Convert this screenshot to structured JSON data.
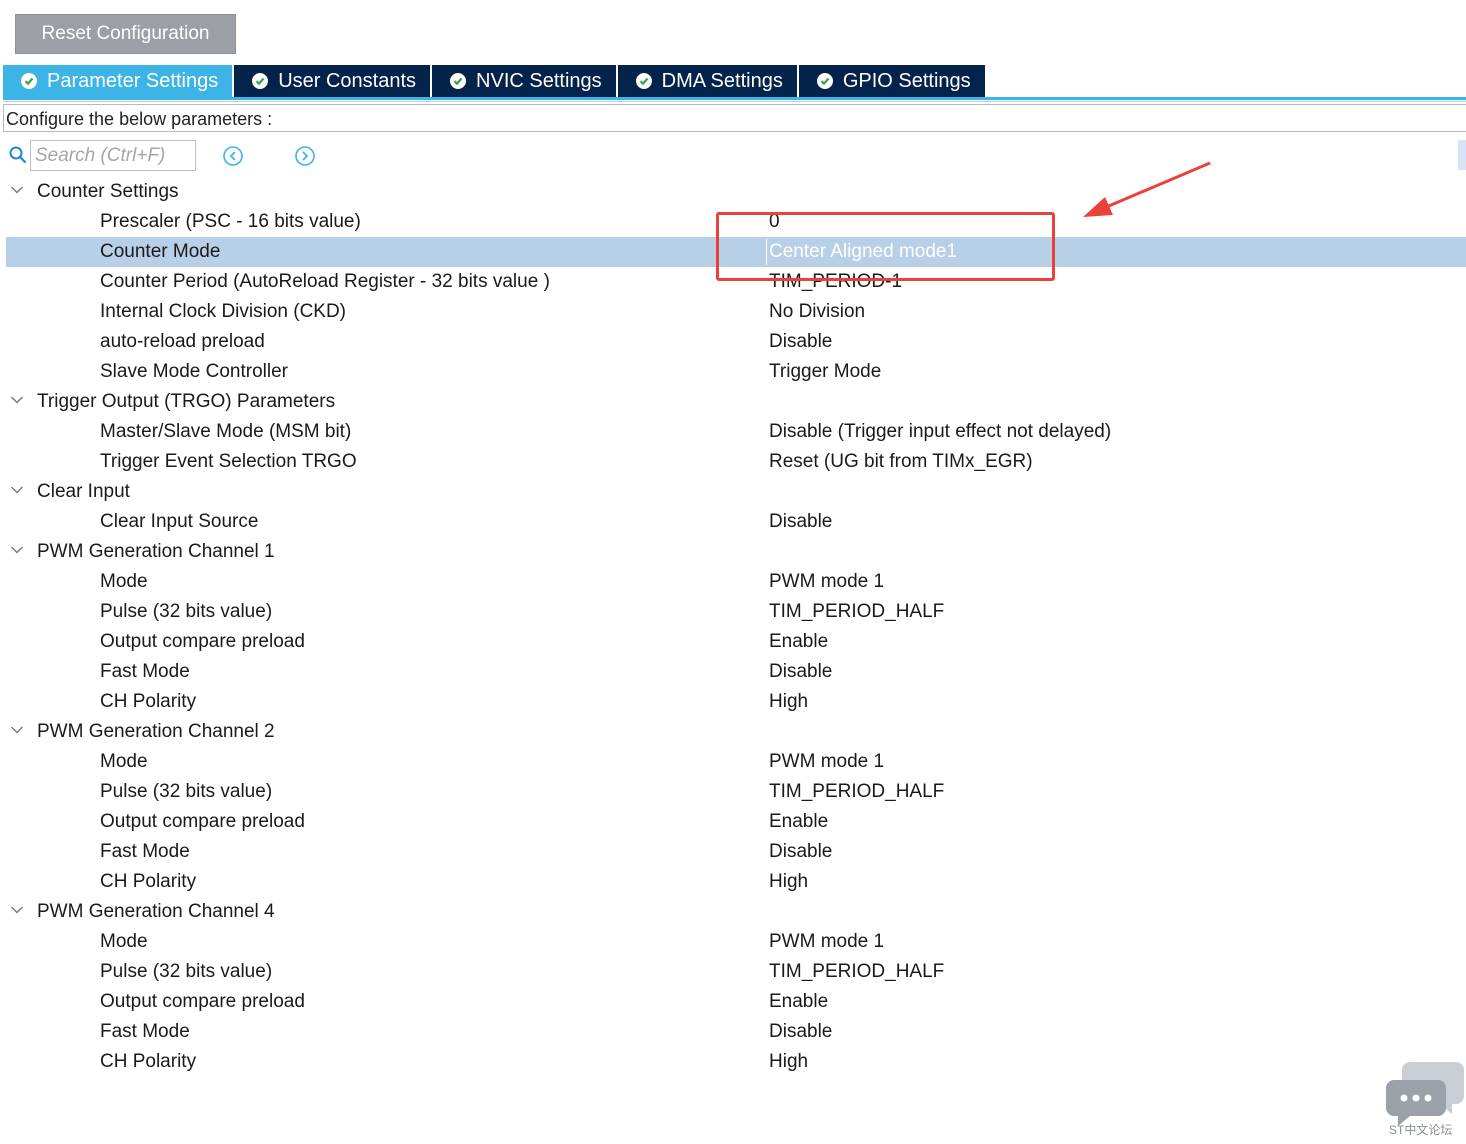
{
  "toolbar": {
    "reset_label": "Reset Configuration"
  },
  "tabs": [
    {
      "label": "Parameter Settings",
      "active": true
    },
    {
      "label": "User Constants",
      "active": false
    },
    {
      "label": "NVIC Settings",
      "active": false
    },
    {
      "label": "DMA Settings",
      "active": false
    },
    {
      "label": "GPIO Settings",
      "active": false
    }
  ],
  "config_label": "Configure the below parameters :",
  "search": {
    "placeholder": "Search (Ctrl+F)",
    "value": ""
  },
  "selected_row": "Counter Mode",
  "groups": [
    {
      "label": "Counter Settings",
      "params": [
        {
          "name": "Prescaler (PSC - 16 bits value)",
          "value": "0"
        },
        {
          "name": "Counter Mode",
          "value": "Center Aligned mode1"
        },
        {
          "name": "Counter Period (AutoReload Register - 32 bits value )",
          "value": "TIM_PERIOD-1"
        },
        {
          "name": "Internal Clock Division (CKD)",
          "value": "No Division"
        },
        {
          "name": "auto-reload preload",
          "value": "Disable"
        },
        {
          "name": "Slave Mode Controller",
          "value": "Trigger Mode"
        }
      ]
    },
    {
      "label": "Trigger Output (TRGO) Parameters",
      "params": [
        {
          "name": "Master/Slave Mode (MSM bit)",
          "value": "Disable (Trigger input effect not delayed)"
        },
        {
          "name": "Trigger Event Selection TRGO",
          "value": "Reset (UG bit from TIMx_EGR)"
        }
      ]
    },
    {
      "label": "Clear Input",
      "params": [
        {
          "name": "Clear Input Source",
          "value": "Disable"
        }
      ]
    },
    {
      "label": "PWM Generation Channel 1",
      "params": [
        {
          "name": "Mode",
          "value": "PWM mode 1"
        },
        {
          "name": "Pulse (32 bits value)",
          "value": "TIM_PERIOD_HALF"
        },
        {
          "name": "Output compare preload",
          "value": "Enable"
        },
        {
          "name": "Fast Mode",
          "value": "Disable"
        },
        {
          "name": "CH Polarity",
          "value": "High"
        }
      ]
    },
    {
      "label": "PWM Generation Channel 2",
      "params": [
        {
          "name": "Mode",
          "value": "PWM mode 1"
        },
        {
          "name": "Pulse (32 bits value)",
          "value": "TIM_PERIOD_HALF"
        },
        {
          "name": "Output compare preload",
          "value": "Enable"
        },
        {
          "name": "Fast Mode",
          "value": "Disable"
        },
        {
          "name": "CH Polarity",
          "value": "High"
        }
      ]
    },
    {
      "label": "PWM Generation Channel 4",
      "params": [
        {
          "name": "Mode",
          "value": "PWM mode 1"
        },
        {
          "name": "Pulse (32 bits value)",
          "value": "TIM_PERIOD_HALF"
        },
        {
          "name": "Output compare preload",
          "value": "Enable"
        },
        {
          "name": "Fast Mode",
          "value": "Disable"
        },
        {
          "name": "CH Polarity",
          "value": "High"
        }
      ]
    }
  ],
  "annotation": {
    "color": "#e8423b"
  },
  "colors": {
    "tab_active": "#3cb4e6",
    "tab_inactive": "#03234b",
    "selection": "#b8cfe8",
    "reset_button": "#9aa0a6"
  },
  "icons": {
    "tab": "check-circle-icon",
    "search": "search-icon",
    "prev": "prev-match-icon",
    "next": "next-match-icon",
    "group": "chevron-down-icon"
  },
  "watermark": {
    "text": "ST中文论坛"
  }
}
